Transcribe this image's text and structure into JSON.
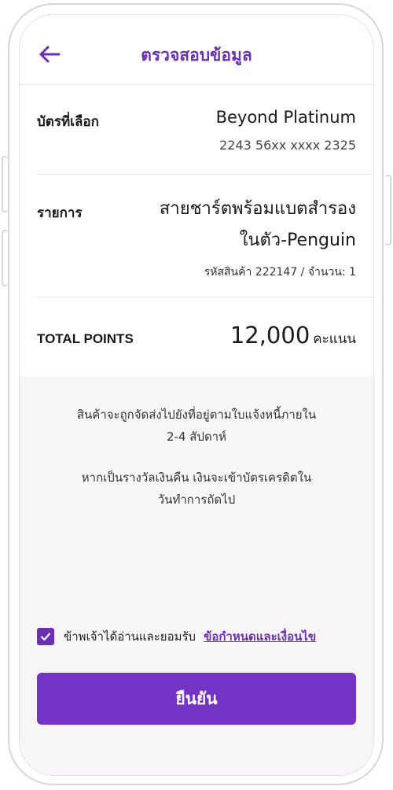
{
  "header": {
    "title": "ตรวจสอบข้อมูล",
    "back_icon": "arrow-left-icon"
  },
  "card": {
    "label": "บัตรที่เลือก",
    "name": "Beyond Platinum",
    "number": "2243 56xx xxxx 2325"
  },
  "item": {
    "label": "รายการ",
    "name_line1": "สายชาร์ตพร้อมแบตสำรอง",
    "name_line2": "ในตัว-Penguin",
    "code_qty": "รหัสสินค้า 222147 / จำนวน: 1"
  },
  "total": {
    "label": "TOTAL POINTS",
    "points": "12,000",
    "unit": "คะแนน"
  },
  "notes": {
    "delivery_line1": "สินค้าจะถูกจัดส่งไปยังที่อยู่ตามใบแจ้งหนี้ภายใน",
    "delivery_line2": "2-4 สัปดาห์",
    "cash_line1": "หากเป็นรางวัลเงินคืน เงินจะเข้าบัตรเครดิตใน",
    "cash_line2": "วันทำการถัดไป"
  },
  "agree": {
    "checked": true,
    "text": "ข้าพเจ้าได้อ่านและยอมรับ",
    "link": "ข้อกำหนดและเงื่อนไข"
  },
  "confirm": {
    "label": "ยืนยัน"
  },
  "colors": {
    "accent": "#7433c4",
    "title": "#6b2fb3",
    "background_gray": "#f7f5f7"
  }
}
